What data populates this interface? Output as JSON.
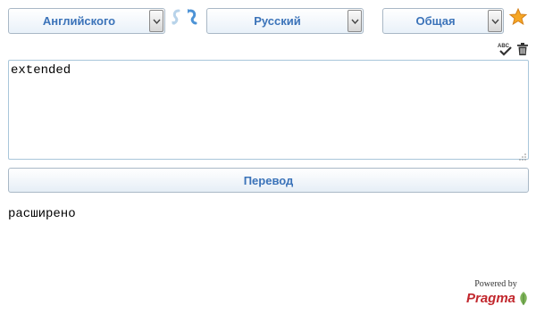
{
  "source_language": {
    "selected": "Английского"
  },
  "target_language": {
    "selected": "Русский"
  },
  "topic": {
    "selected": "Общая"
  },
  "input": {
    "value": "extended"
  },
  "translate_button": {
    "label": "Перевод"
  },
  "output": {
    "text": "расширено"
  },
  "footer": {
    "powered_by": "Powered by",
    "brand": "Pragma"
  },
  "icons": {
    "swap": "swap-languages-icon",
    "favorite": "star-icon",
    "spellcheck": "spellcheck-icon",
    "clear": "trash-icon",
    "resize": "resize-handle-icon",
    "brand_leaf": "leaf-icon"
  },
  "colors": {
    "accent": "#3b73b9",
    "border": "#a9b8c6",
    "brand": "#c2272d",
    "star": "#f0a020"
  }
}
